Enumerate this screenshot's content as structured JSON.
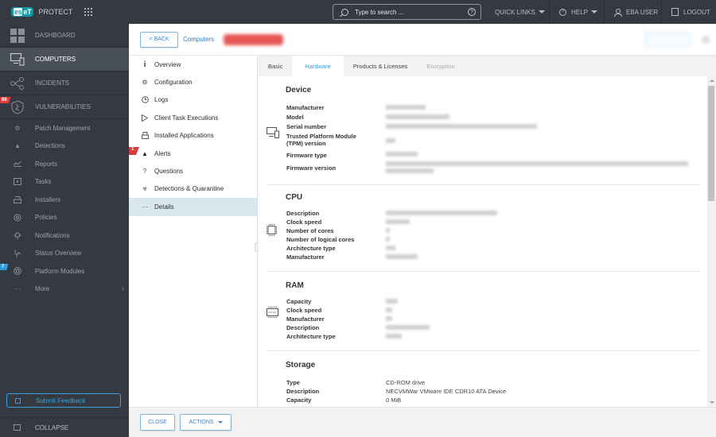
{
  "topbar": {
    "brand": "eset",
    "product": "PROTECT",
    "search_placeholder": "Type to search ...",
    "quick_links": "QUICK LINKS",
    "help": "HELP",
    "user": "EBA USER",
    "logout": "LOGOUT"
  },
  "sidebar": {
    "main_items": [
      {
        "label": "DASHBOARD",
        "icon": "dashboard-icon"
      },
      {
        "label": "COMPUTERS",
        "icon": "computers-icon",
        "active": true
      },
      {
        "label": "INCIDENTS",
        "icon": "incidents-icon"
      },
      {
        "label": "VULNERABILITIES",
        "icon": "vulnerabilities-icon",
        "badge": "89"
      }
    ],
    "sub_items": [
      {
        "label": "Patch Management",
        "icon": "patch-management-icon"
      },
      {
        "label": "Detections",
        "icon": "warning-icon"
      },
      {
        "label": "Reports",
        "icon": "reports-icon"
      },
      {
        "label": "Tasks",
        "icon": "tasks-icon"
      },
      {
        "label": "Installers",
        "icon": "installers-icon"
      },
      {
        "label": "Policies",
        "icon": "policies-icon"
      },
      {
        "label": "Notifications",
        "icon": "notifications-icon"
      },
      {
        "label": "Status Overview",
        "icon": "status-overview-icon"
      },
      {
        "label": "Platform Modules",
        "icon": "platform-modules-icon",
        "badge": "7"
      },
      {
        "label": "More",
        "icon": "more-icon"
      }
    ],
    "feedback": "Submit Feedback",
    "collapse": "COLLAPSE",
    "badge_colors": {
      "vulnerabilities": "#e03c3c",
      "platform_modules": "#2f9ee0"
    }
  },
  "header": {
    "back": "< BACK",
    "breadcrumb_root": "Computers",
    "breadcrumb_current": ""
  },
  "detail_nav": {
    "items": [
      {
        "label": "Overview",
        "icon": "info-icon"
      },
      {
        "label": "Configuration",
        "icon": "configuration-icon"
      },
      {
        "label": "Logs",
        "icon": "logs-icon"
      },
      {
        "label": "Client Task Executions",
        "icon": "play-icon"
      },
      {
        "label": "Installed Applications",
        "icon": "applications-icon"
      },
      {
        "label": "Alerts",
        "icon": "alert-icon",
        "badge": "1"
      },
      {
        "label": "Questions",
        "icon": "question-icon"
      },
      {
        "label": "Detections & Quarantine",
        "icon": "quarantine-icon"
      },
      {
        "label": "Details",
        "icon": "ellipsis-icon",
        "active": true
      }
    ]
  },
  "tabs": [
    {
      "label": "Basic"
    },
    {
      "label": "Hardware",
      "active": true
    },
    {
      "label": "Products & Licenses"
    },
    {
      "label": "Encryption",
      "disabled": true
    }
  ],
  "hardware": {
    "device": {
      "title": "Device",
      "labels": [
        "Manufacturer",
        "Model",
        "Serial number",
        "Trusted Platform Module (TPM) version",
        "Firmware type",
        "Firmware version"
      ],
      "values": [
        "",
        "",
        "",
        "",
        "",
        ""
      ]
    },
    "cpu": {
      "title": "CPU",
      "labels": [
        "Description",
        "Clock speed",
        "Number of cores",
        "Number of logical cores",
        "Architecture type",
        "Manufacturer"
      ],
      "values": [
        "",
        "",
        "",
        "",
        "",
        ""
      ]
    },
    "ram": {
      "title": "RAM",
      "labels": [
        "Capacity",
        "Clock speed",
        "Manufacturer",
        "Description",
        "Architecture type"
      ],
      "values": [
        "",
        "",
        "",
        "",
        ""
      ]
    },
    "storage": {
      "title": "Storage",
      "labels": [
        "Type",
        "Description",
        "Capacity"
      ],
      "values": [
        "CD-ROM drive",
        "NECVMWar VMware IDE CDR10 ATA Device",
        "0 MiB"
      ]
    }
  },
  "footer": {
    "close": "CLOSE",
    "actions": "ACTIONS"
  }
}
